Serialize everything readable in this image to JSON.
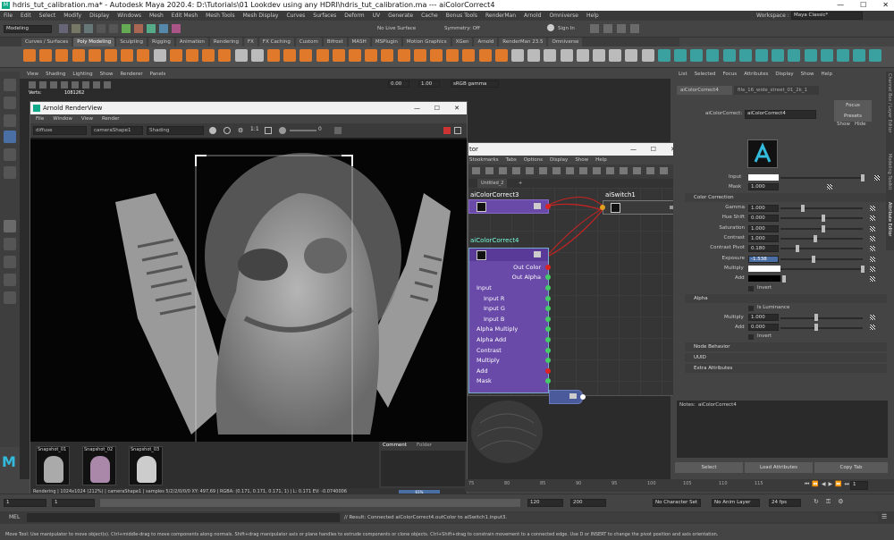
{
  "window": {
    "title": "hdris_tut_calibration.ma* - Autodesk Maya 2020.4: D:\\Tutorials\\01 Lookdev using any HDRI\\hdris_tut_calibration.ma   ---   aiColorCorrect4",
    "workspace_label": "Workspace :",
    "workspace_value": "Maya Classic*"
  },
  "menubar": [
    "File",
    "Edit",
    "Select",
    "Modify",
    "Display",
    "Windows",
    "Mesh",
    "Edit Mesh",
    "Mesh Tools",
    "Mesh Display",
    "Curves",
    "Surfaces",
    "Deform",
    "UV",
    "Generate",
    "Cache",
    "Bonus Tools",
    "RenderMan",
    "Arnold",
    "Omniverse",
    "Help"
  ],
  "statusline": {
    "menuset": "Modeling",
    "live_surface": "No Live Surface",
    "symmetry": "Symmetry: Off",
    "sign_in": "Sign In"
  },
  "shelf_tabs": [
    "Curves / Surfaces",
    "Poly Modeling",
    "Sculpting",
    "Rigging",
    "Animation",
    "Rendering",
    "FX",
    "FX Caching",
    "Custom",
    "Bifrost",
    "MASH",
    "MSPlugin",
    "Motion Graphics",
    "XGen",
    "Arnold",
    "RenderMan 23.5",
    "Omniverse"
  ],
  "shelf_active": "Poly Modeling",
  "panel_menu": [
    "View",
    "Shading",
    "Lighting",
    "Show",
    "Renderer",
    "Panels"
  ],
  "panel_values": {
    "a": "0.00",
    "b": "1.00",
    "colorspace": "sRGB gamma",
    "verts": "Verts:",
    "verts_count": "1081262"
  },
  "render_view": {
    "title": "Arnold RenderView",
    "menu": [
      "File",
      "Window",
      "View",
      "Render"
    ],
    "aov": "diffuse",
    "camera": "cameraShape1",
    "mode": "Shading",
    "ratio": "1:1",
    "exposure": "0",
    "snapshots": [
      "Snapshot_01",
      "Snapshot_02",
      "Snapshot_03"
    ],
    "tabs": [
      "Comment",
      "Folder"
    ],
    "status": "Rendering | 1024x1024 (212%) | cameraShape1 | samples 5/2/2/0/0/0 XY: 497,69  |  RGBA: (0.171, 0.171, 0.171, 1)  |  L: 0.171 EV: -0.0740006",
    "progress": "61%"
  },
  "node_editor": {
    "title": "tor",
    "menu": [
      "Stookmarks",
      "Tabs",
      "Options",
      "Display",
      "Show",
      "Help"
    ],
    "tab": "Untitled_2",
    "node_cc3": "aiColorCorrect3",
    "node_cc4": "aiColorCorrect4",
    "node_switch": "aiSwitch1",
    "outputs": [
      "Out Color",
      "Out Alpha"
    ],
    "inputs": [
      "Input",
      "Input R",
      "Input G",
      "Input B",
      "Alpha Multiply",
      "Alpha Add",
      "Contrast",
      "Multiply",
      "Add",
      "Mask"
    ]
  },
  "attr_editor": {
    "menu": [
      "List",
      "Selected",
      "Focus",
      "Attributes",
      "Display",
      "Show",
      "Help"
    ],
    "node_tab": "aiColorCorrect4",
    "file_tab": "file_16_wide_street_01_2k_1",
    "node_label": "aiColorCorrect:",
    "node_name": "aiColorCorrect4",
    "buttons": {
      "focus": "Focus",
      "presets": "Presets",
      "show": "Show",
      "hide": "Hide"
    },
    "input_label": "Input",
    "mask_label": "Mask",
    "mask_value": "1.000",
    "color_correction_header": "Color Correction",
    "fields": [
      {
        "label": "Gamma",
        "value": "1.000",
        "level": 0.25
      },
      {
        "label": "Hue Shift",
        "value": "0.000",
        "level": 0.5
      },
      {
        "label": "Saturation",
        "value": "1.000",
        "level": 0.5
      },
      {
        "label": "Contrast",
        "value": "1.000",
        "level": 0.4
      },
      {
        "label": "Contrast Pivot",
        "value": "0.180",
        "level": 0.18
      },
      {
        "label": "Exposure",
        "value": "-1.538",
        "level": 0.38
      }
    ],
    "multiply_label": "Multiply",
    "add_label": "Add",
    "invert_label": "Invert",
    "alpha_header": "Alpha",
    "is_luminance": "Is Luminance",
    "alpha_multiply": "1.000",
    "alpha_add": "0.000",
    "alpha_invert": "Invert",
    "sections": [
      "Node Behavior",
      "UUID",
      "Extra Attributes"
    ],
    "notes_label": "Notes:",
    "notes_node": "aiColorCorrect4",
    "bottom_buttons": [
      "Select",
      "Load Attributes",
      "Copy Tab"
    ]
  },
  "right_tabs": [
    "Channel Box / Layer Editor",
    "Modeling Toolkit",
    "Attribute Editor"
  ],
  "timeline": {
    "ticks": [
      "75",
      "80",
      "85",
      "90",
      "95",
      "100",
      "105",
      "110",
      "115"
    ],
    "current": "1"
  },
  "range": {
    "start": "1",
    "inner_start": "1",
    "current": "120",
    "inner_end": "120",
    "end": "200",
    "char_set": "No Character Set",
    "anim_layer": "No Anim Layer",
    "fps": "24 fps"
  },
  "cmdline": {
    "label": "MEL",
    "result": "// Result: Connected aiColorCorrect4.outColor to aiSwitch1.input3."
  },
  "helpline": "Move Tool: Use manipulator to move object(s). Ctrl+middle-drag to move components along normals. Shift+drag manipulator axis or plane handles to extrude components or clone objects. Ctrl+Shift+drag to constrain movement to a connected edge. Use D or INSERT to change the pivot position and axis orientation."
}
